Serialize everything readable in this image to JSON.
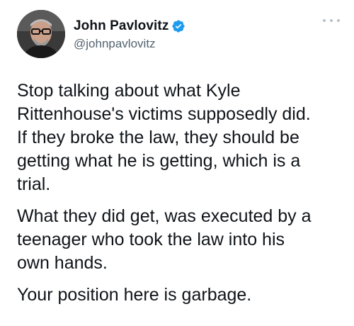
{
  "author": {
    "display_name": "John Pavlovitz",
    "handle": "@johnpavlovitz",
    "verified": true,
    "verified_color": "#1d9bf0"
  },
  "menu": {
    "icon": "more-horizontal-icon"
  },
  "tweet": {
    "paragraphs": [
      {
        "lines": [
          "Stop talking about what Kyle",
          "Rittenhouse's victims supposedly did.",
          "If they broke the law, they should be",
          "getting what he is getting, which is a",
          "trial."
        ]
      },
      {
        "lines": [
          "What they did get, was executed by a",
          "teenager who took the law into his",
          "own hands."
        ]
      },
      {
        "lines": [
          "Your position here is garbage."
        ]
      }
    ]
  }
}
